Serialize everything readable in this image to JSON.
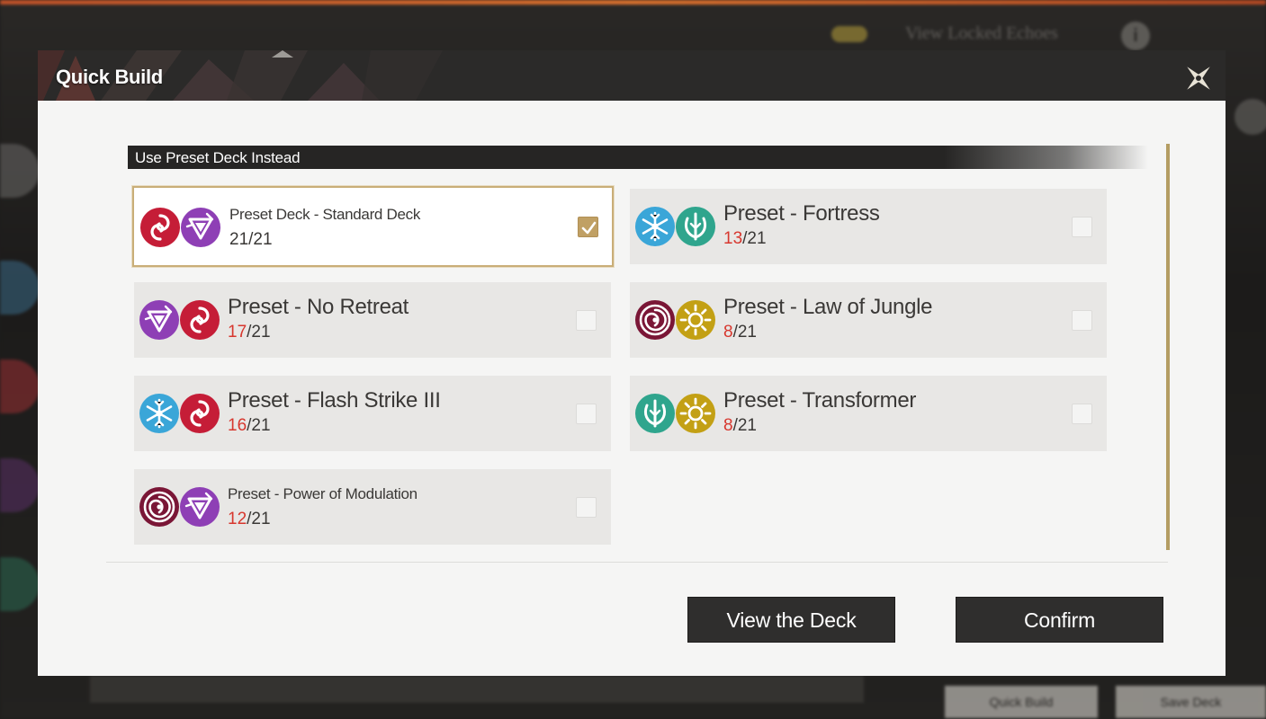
{
  "background": {
    "locked_label": "View Locked Echoes",
    "info_symbol": "i",
    "bottom_buttons": [
      "Quick Build",
      "Save Deck"
    ]
  },
  "dialog": {
    "title": "Quick Build",
    "close_icon": "close-x-icon"
  },
  "section": {
    "label": "Use Preset Deck Instead"
  },
  "colors": {
    "crimson": "#c51d37",
    "violet": "#8e3fb5",
    "ice": "#3aa6d8",
    "jade": "#2fa58d",
    "maroon": "#7a1636",
    "gold": "#c3a014",
    "count_low": "#d7372e",
    "accent_check": "#c0a064"
  },
  "presets": [
    {
      "name": "Preset Deck - Standard Deck",
      "owned": "21",
      "total": "/21",
      "selected": true,
      "icons": [
        "fusion-spiral-icon",
        "electro-triangle-icon"
      ]
    },
    {
      "name": "Preset - Fortress",
      "owned": "13",
      "total": "/21",
      "selected": false,
      "icons": [
        "glacio-snowflake-icon",
        "aero-leaf-icon"
      ]
    },
    {
      "name": "Preset - No Retreat",
      "owned": "17",
      "total": "/21",
      "selected": false,
      "icons": [
        "electro-triangle-icon",
        "fusion-spiral-icon"
      ]
    },
    {
      "name": "Preset - Law of Jungle",
      "owned": "8",
      "total": "/21",
      "selected": false,
      "icons": [
        "havoc-swirl-icon",
        "spectro-sun-icon"
      ]
    },
    {
      "name": "Preset - Flash Strike III",
      "owned": "16",
      "total": "/21",
      "selected": false,
      "icons": [
        "glacio-snowflake-icon",
        "fusion-spiral-icon"
      ]
    },
    {
      "name": "Preset - Transformer",
      "owned": "8",
      "total": "/21",
      "selected": false,
      "icons": [
        "aero-leaf-icon",
        "spectro-sun-icon"
      ]
    },
    {
      "name": "Preset - Power of Modulation",
      "owned": "12",
      "total": "/21",
      "selected": false,
      "icons": [
        "havoc-swirl-icon",
        "electro-triangle-icon"
      ]
    }
  ],
  "buttons": {
    "view_deck": "View the Deck",
    "confirm": "Confirm"
  }
}
